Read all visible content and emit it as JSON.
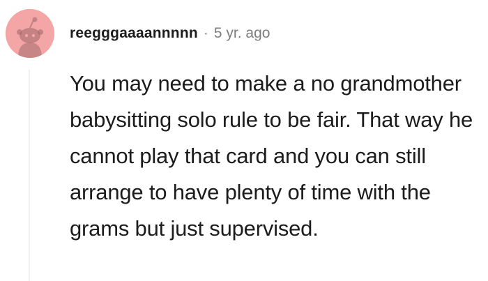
{
  "comment": {
    "author": "reegggaaaannnnn",
    "separator": "·",
    "timestamp": "5 yr. ago",
    "avatar_icon": "snoo-avatar-icon",
    "avatar_color": "#f4a6a6",
    "body": "You may need to make a no grandmother babysitting solo rule to be fair. That way he cannot play that card and you can still arrange to have plenty of time with the grams but just supervised."
  }
}
